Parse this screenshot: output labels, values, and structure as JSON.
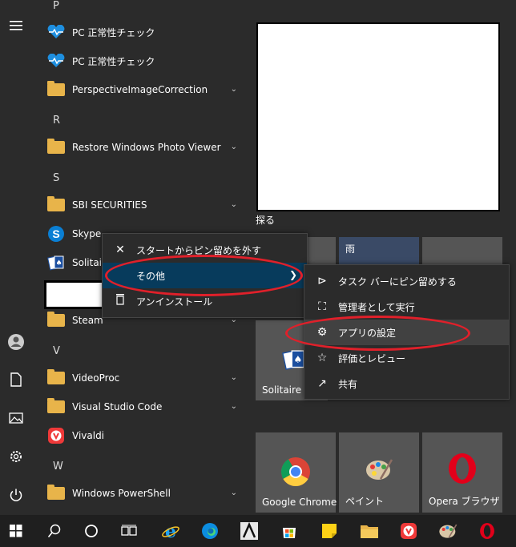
{
  "app_list": {
    "letters": {
      "p": "P",
      "r": "R",
      "s": "S",
      "v": "V",
      "w": "W"
    },
    "items": {
      "pc_health_1": "PC 正常性チェック",
      "pc_health_2": "PC 正常性チェック",
      "perspective": "PerspectiveImageCorrection",
      "restore_photo": "Restore Windows Photo Viewer",
      "sbi": "SBI SECURITIES",
      "skype": "Skype",
      "solitaire": "Solitair",
      "steam": "Steam",
      "videoproc": "VideoProc",
      "vscode": "Visual Studio Code",
      "vivaldi": "Vivaldi",
      "powershell": "Windows PowerShell"
    }
  },
  "tiles": {
    "explore_label": "探る",
    "weather_label": "雨",
    "solitaire_label": "Solitaire",
    "chrome_label": "Google Chrome",
    "paint_label": "ペイント",
    "opera_label": "Opera ブラウザ"
  },
  "context_menu": {
    "unpin": "スタートからピン留めを外す",
    "more": "その他",
    "uninstall": "アンインストール"
  },
  "submenu": {
    "pin_taskbar": "タスク バーにピン留めする",
    "run_admin": "管理者として実行",
    "app_settings": "アプリの設定",
    "rate_review": "評価とレビュー",
    "share": "共有"
  },
  "colors": {
    "accent_blue": "#0078d7",
    "highlight_ring": "#e0202a",
    "folder": "#e8b44a",
    "menu_bg": "#2b2b2b",
    "selected_item": "#073b5c",
    "hover_item": "#414141"
  },
  "icons": {
    "menu": "hamburger-icon",
    "user": "user-icon",
    "documents": "document-icon",
    "pictures": "picture-icon",
    "settings": "gear-icon",
    "power": "power-icon"
  }
}
